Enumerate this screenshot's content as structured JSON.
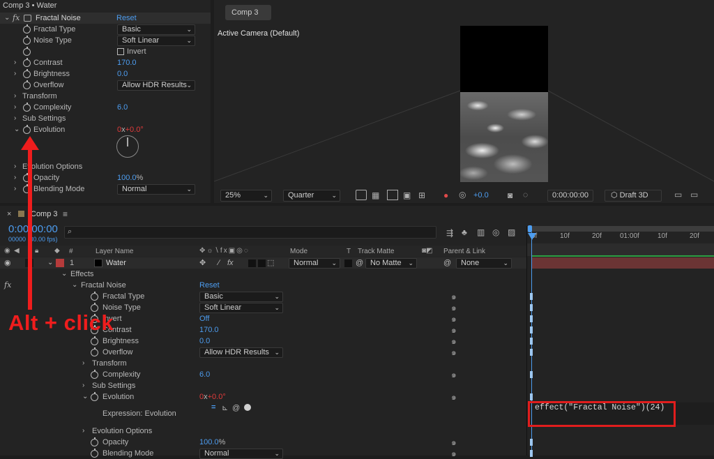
{
  "effect_controls": {
    "title": "Comp 3 • Water",
    "effect_name": "Fractal Noise",
    "reset": "Reset",
    "fractal_type": {
      "label": "Fractal Type",
      "value": "Basic"
    },
    "noise_type": {
      "label": "Noise Type",
      "value": "Soft Linear"
    },
    "invert": {
      "label": "Invert"
    },
    "contrast": {
      "label": "Contrast",
      "value": "170.0"
    },
    "brightness": {
      "label": "Brightness",
      "value": "0.0"
    },
    "overflow": {
      "label": "Overflow",
      "value": "Allow HDR Results"
    },
    "transform": "Transform",
    "complexity": {
      "label": "Complexity",
      "value": "6.0"
    },
    "sub_settings": "Sub Settings",
    "evolution": {
      "label": "Evolution",
      "value_rev": "0",
      "value_x": "x",
      "value_deg": "+0.0°"
    },
    "evolution_options": "Evolution Options",
    "opacity": {
      "label": "Opacity",
      "value": "100.0",
      "unit": "%"
    },
    "blending": {
      "label": "Blending Mode",
      "value": "Normal"
    }
  },
  "viewer": {
    "tab": "Comp 3",
    "camera": "Active Camera (Default)",
    "zoom": "25%",
    "resolution": "Quarter",
    "exposure": "+0.0",
    "timecode": "0:00:00:00",
    "renderer": "Draft 3D"
  },
  "timeline": {
    "comp_name": "Comp 3",
    "menu_icon": "≡",
    "timecode": "0:00:00:00",
    "fps": "00000 (30.00 fps)",
    "search_placeholder": "",
    "headers": {
      "num": "#",
      "layer_name": "Layer Name",
      "mode": "Mode",
      "t": "T",
      "track_matte": "Track Matte",
      "parent": "Parent & Link"
    },
    "ruler": [
      "0f",
      "10f",
      "20f",
      "01:00f",
      "10f",
      "20f"
    ],
    "layer": {
      "num": "1",
      "name": "Water",
      "mode": "Normal",
      "matte": "No Matte",
      "parent": "None"
    },
    "effects": "Effects",
    "effect_name": "Fractal Noise",
    "reset": "Reset",
    "fractal_type": {
      "label": "Fractal Type",
      "value": "Basic"
    },
    "noise_type": {
      "label": "Noise Type",
      "value": "Soft Linear"
    },
    "invert": {
      "label": "Invert",
      "value": "Off"
    },
    "contrast": {
      "label": "Contrast",
      "value": "170.0"
    },
    "brightness": {
      "label": "Brightness",
      "value": "0.0"
    },
    "overflow": {
      "label": "Overflow",
      "value": "Allow HDR Results"
    },
    "transform": "Transform",
    "complexity": {
      "label": "Complexity",
      "value": "6.0"
    },
    "sub_settings": "Sub Settings",
    "evolution": {
      "label": "Evolution",
      "value_rev": "0",
      "value_x": "x",
      "value_deg": "+0.0°"
    },
    "expression_label": "Expression: Evolution",
    "expression_text": "effect(\"Fractal Noise\")(24)",
    "evolution_options": "Evolution Options",
    "opacity": {
      "label": "Opacity",
      "value": "100.0",
      "unit": "%"
    },
    "blending": {
      "label": "Blending Mode",
      "value": "Normal"
    }
  },
  "annotation": "Alt + click",
  "colors": {
    "accent": "#4d9df0",
    "annotation": "#ef1d1d",
    "keyframe_value_red": "#e23b3b"
  }
}
